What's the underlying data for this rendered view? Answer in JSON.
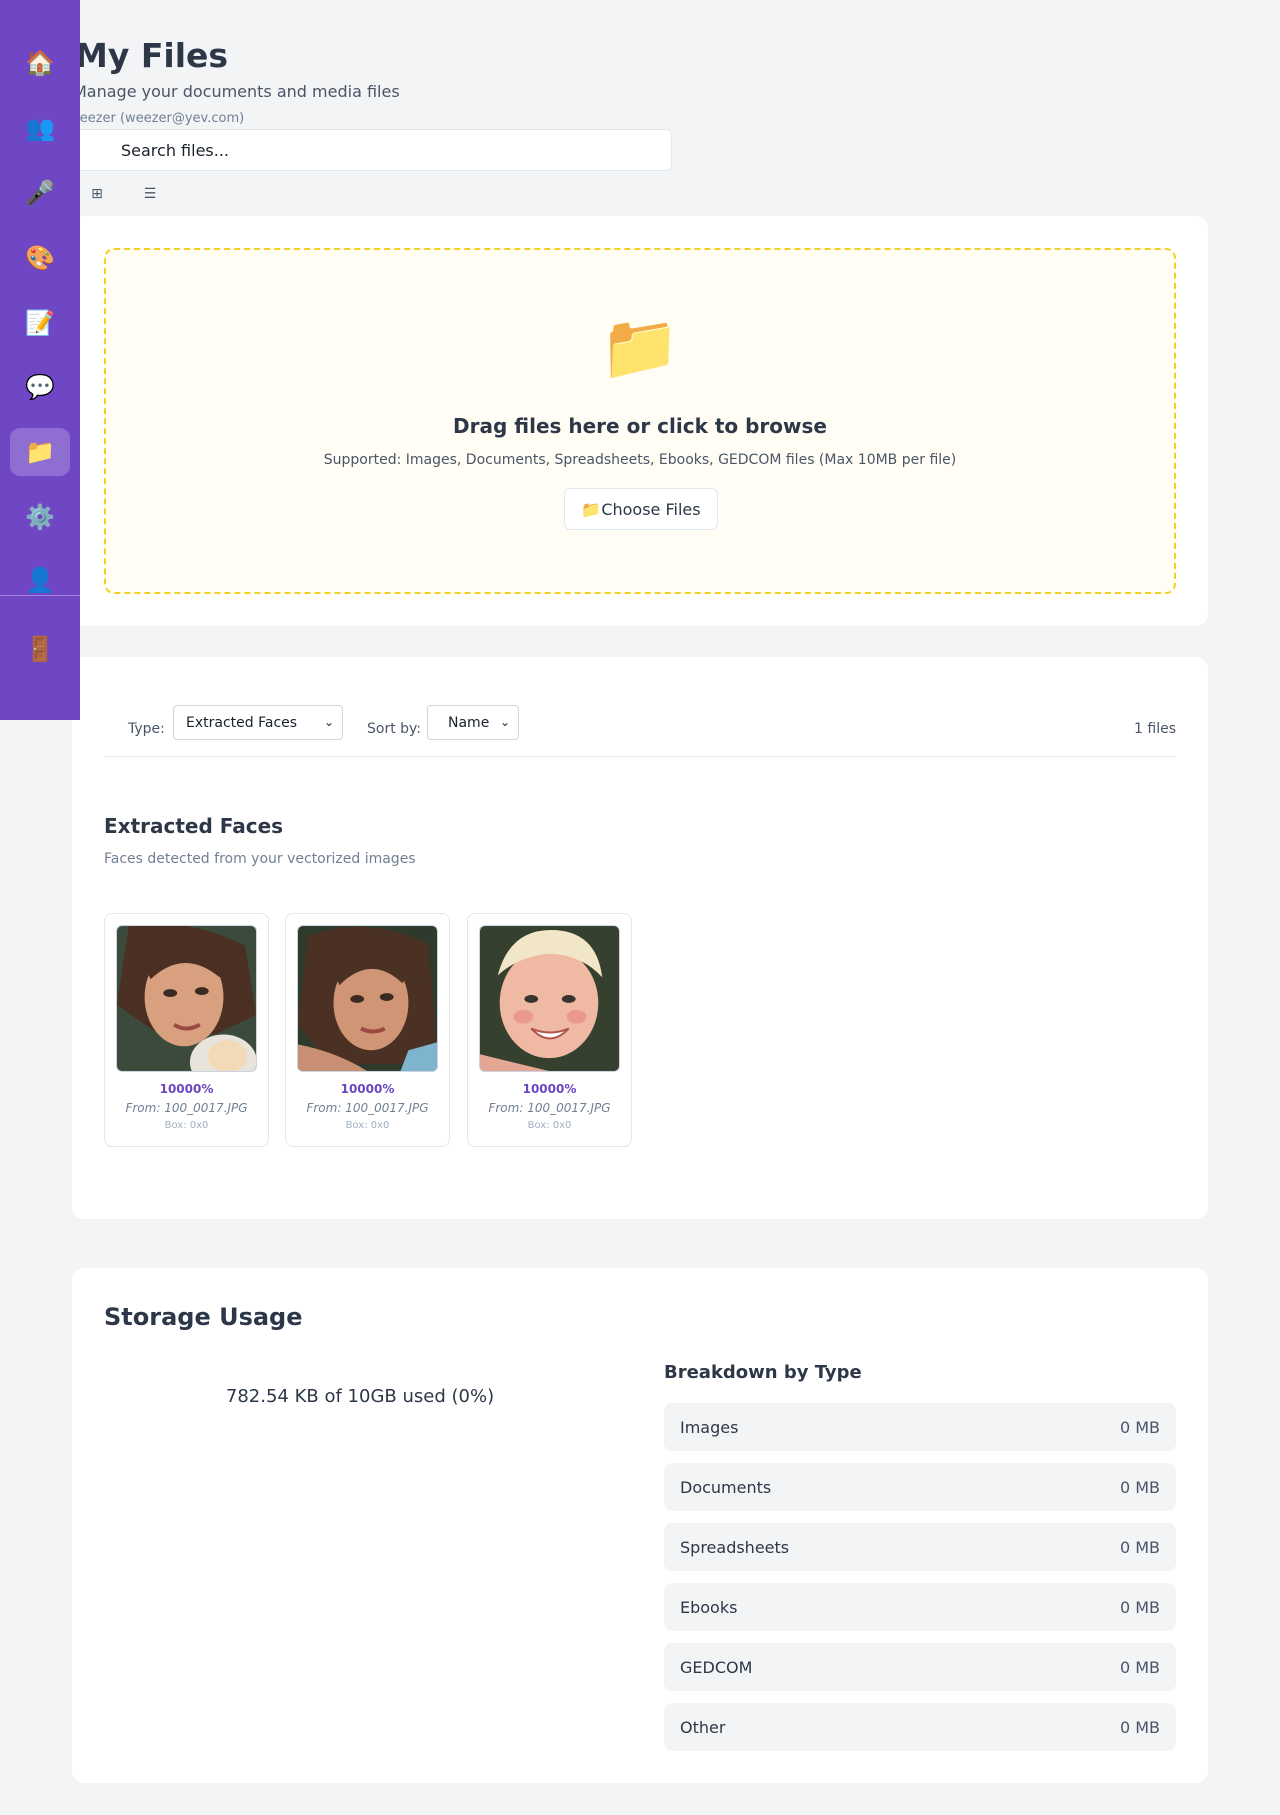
{
  "sidebar": {
    "items": [
      {
        "icon": "home-icon",
        "glyph": "🏠"
      },
      {
        "icon": "people-icon",
        "glyph": "👥"
      },
      {
        "icon": "microphone-icon",
        "glyph": "🎤"
      },
      {
        "icon": "palette-icon",
        "glyph": "🎨"
      },
      {
        "icon": "memo-icon",
        "glyph": "📝"
      },
      {
        "icon": "speech-bubble-icon",
        "glyph": "💬"
      },
      {
        "icon": "folder-icon",
        "glyph": "📁",
        "active": true
      },
      {
        "icon": "gear-icon",
        "glyph": "⚙️"
      },
      {
        "icon": "user-icon",
        "glyph": "👤"
      }
    ],
    "logout": {
      "icon": "door-icon",
      "glyph": "🚪"
    },
    "color": "#6f46c4"
  },
  "header": {
    "title": "My Files",
    "subtitle": "Manage your documents and media files",
    "user": "veezer (weezer@yev.com)"
  },
  "search": {
    "placeholder": "Search files..."
  },
  "view_toggle": {
    "grid_glyph": "⊞",
    "list_glyph": "☰"
  },
  "upload": {
    "folder_glyph": "📁",
    "title": "Drag files here or click to browse",
    "hint": "Supported: Images, Documents, Spreadsheets, Ebooks, GEDCOM files (Max 10MB per file)",
    "button_label": "📁Choose Files"
  },
  "filters": {
    "type_label": "Type:",
    "type_value": "Extracted Faces",
    "sort_label": "Sort by:",
    "sort_value": "Name",
    "count": "1 files"
  },
  "faces": {
    "title": "Extracted Faces",
    "description": "Faces detected from your vectorized images",
    "items": [
      {
        "score": "10000%",
        "from": "From: 100_0017.JPG",
        "box": "Box: 0x0"
      },
      {
        "score": "10000%",
        "from": "From: 100_0017.JPG",
        "box": "Box: 0x0"
      },
      {
        "score": "10000%",
        "from": "From: 100_0017.JPG",
        "box": "Box: 0x0"
      }
    ]
  },
  "storage": {
    "title": "Storage Usage",
    "used": "782.54 KB of 10GB used (0%)",
    "used_fraction": 0,
    "breakdown_title": "Breakdown by Type",
    "breakdown": [
      {
        "name": "Images",
        "size": "0 MB"
      },
      {
        "name": "Documents",
        "size": "0 MB"
      },
      {
        "name": "Spreadsheets",
        "size": "0 MB"
      },
      {
        "name": "Ebooks",
        "size": "0 MB"
      },
      {
        "name": "GEDCOM",
        "size": "0 MB"
      },
      {
        "name": "Other",
        "size": "0 MB"
      }
    ]
  },
  "colors": {
    "accent": "#6b46c1",
    "dropzone_border": "#f5d020"
  }
}
